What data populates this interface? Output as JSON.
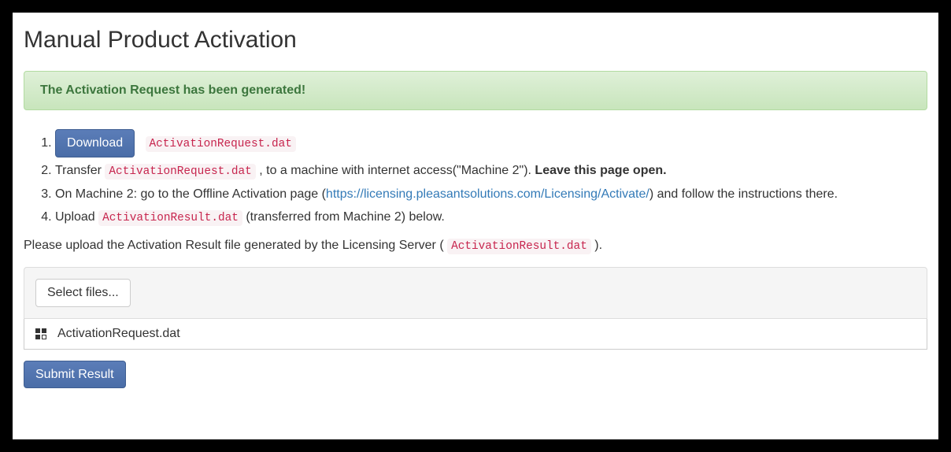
{
  "title": "Manual Product Activation",
  "alert": "The Activation Request has been generated!",
  "steps": {
    "download_label": "Download",
    "request_file": "ActivationRequest.dat",
    "step2_prefix": "Transfer ",
    "step2_mid": ", to a machine with internet access(\"Machine 2\"). ",
    "step2_bold": "Leave this page open.",
    "step3_prefix": "On Machine 2: go to the Offline Activation page (",
    "step3_link": "https://licensing.pleasantsolutions.com/Licensing/Activate/",
    "step3_suffix": ") and follow the instructions there.",
    "step4_prefix": "Upload ",
    "result_file": "ActivationResult.dat",
    "step4_suffix": " (transferred from Machine 2) below."
  },
  "prompt": {
    "prefix": "Please upload the Activation Result file generated by the Licensing Server ( ",
    "file": "ActivationResult.dat",
    "suffix": " )."
  },
  "upload": {
    "select_label": "Select files...",
    "selected_file": "ActivationRequest.dat"
  },
  "submit_label": "Submit Result"
}
